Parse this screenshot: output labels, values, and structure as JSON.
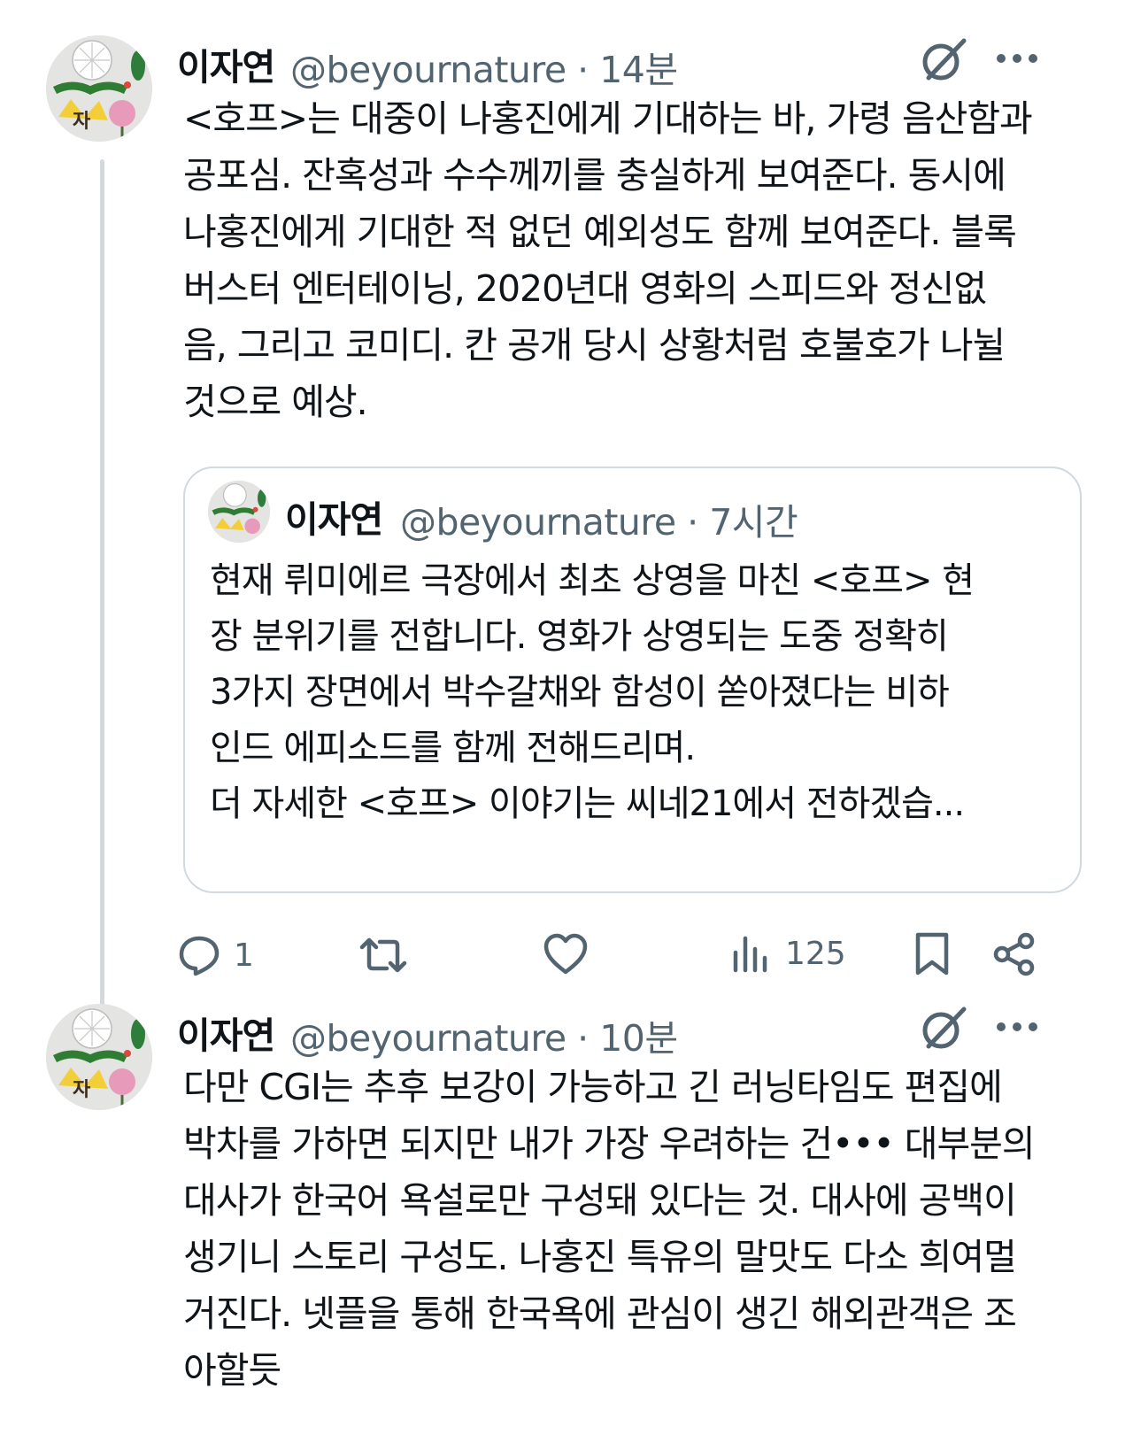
{
  "tweets": [
    {
      "author_name": "이자연",
      "handle": "@beyournature",
      "time": "14분",
      "text_lines": [
        "<호프>는 대중이 나홍진에게 기대하는 바, 가령 음산함과",
        "공포심. 잔혹성과 수수께끼를 충실하게 보여준다. 동시에",
        "나홍진에게 기대한 적 없던 예외성도 함께 보여준다. 블록",
        "버스터 엔터테이닝, 2020년대 영화의 스피드와 정신없",
        "음, 그리고 코미디. 칸 공개 당시 상황처럼 호불호가 나뉠",
        "것으로 예상."
      ],
      "quote": {
        "author_name": "이자연",
        "handle": "@beyournature",
        "time": "7시간",
        "text_lines": [
          "현재 뤼미에르 극장에서 최초 상영을 마친 <호프> 현",
          "장 분위기를 전합니다. 영화가 상영되는 도중 정확히",
          "3가지 장면에서 박수갈채와 함성이 쏟아졌다는 비하",
          "인드 에피소드를 함께 전해드리며.",
          "더 자세한 <호프> 이야기는 씨네21에서 전하겠습..."
        ]
      },
      "actions": {
        "replies": "1",
        "views": "125"
      }
    },
    {
      "author_name": "이자연",
      "handle": "@beyournature",
      "time": "10분",
      "text_lines": [
        "다만 CGI는 추후 보강이 가능하고 긴 러닝타임도 편집에",
        "박차를 가하면 되지만 내가 가장 우려하는 건••• 대부분의",
        "대사가 한국어 욕설로만 구성돼 있다는 것. 대사에 공백이",
        "생기니 스토리 구성도. 나홍진 특유의 말맛도 다소 희여멀",
        "거진다. 넷플을 통해 한국욕에 관심이 생긴 해외관객은 조",
        "아할듯"
      ]
    }
  ],
  "colors": {
    "text": "#0f1419",
    "secondary": "#536471",
    "border": "#cfd9de"
  },
  "icons": [
    "avatar",
    "grok-icon",
    "more-icon",
    "reply-icon",
    "repost-icon",
    "like-icon",
    "views-icon",
    "bookmark-icon",
    "share-icon"
  ]
}
